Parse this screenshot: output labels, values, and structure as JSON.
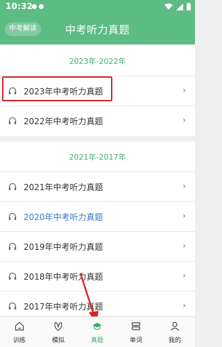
{
  "status": {
    "time": "10:32"
  },
  "header": {
    "left_chip": "中考解读",
    "title": "中考听力真题"
  },
  "sections": [
    {
      "title": "2023年-2022年",
      "items": [
        {
          "label": "2023年中考听力真题"
        },
        {
          "label": "2022年中考听力真题"
        }
      ]
    },
    {
      "title": "2021年-2017年",
      "items": [
        {
          "label": "2021年中考听力真题"
        },
        {
          "label": "2020年中考听力真题"
        },
        {
          "label": "2019年中考听力真题"
        },
        {
          "label": "2018年中考听力真题"
        },
        {
          "label": "2017年中考听力真题"
        }
      ]
    }
  ],
  "tabs": [
    {
      "label": "训练",
      "icon": "home-icon"
    },
    {
      "label": "模拟",
      "icon": "leaf-icon"
    },
    {
      "label": "真题",
      "icon": "graduation-cap-icon"
    },
    {
      "label": "单词",
      "icon": "cards-icon"
    },
    {
      "label": "我的",
      "icon": "user-icon"
    }
  ],
  "colors": {
    "brand": "#5dbb84",
    "accent": "#43ad6b",
    "highlight": "#d72525",
    "link": "#3a78c4"
  }
}
